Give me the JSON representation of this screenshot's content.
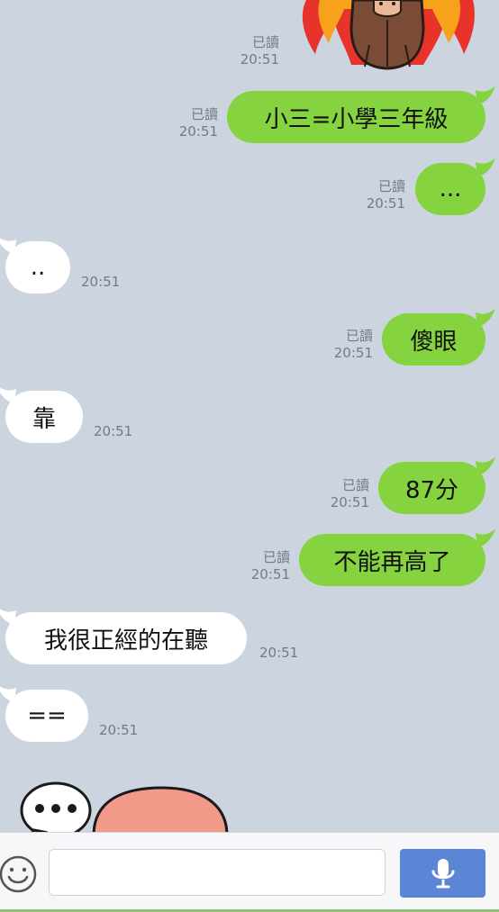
{
  "messages": [
    {
      "text": "小三=小學三年級",
      "read": "已讀",
      "time": "20:51"
    },
    {
      "text": "...",
      "read": "已讀",
      "time": "20:51"
    },
    {
      "text": "..",
      "time": "20:51"
    },
    {
      "text": "傻眼",
      "read": "已讀",
      "time": "20:51"
    },
    {
      "text": "靠",
      "time": "20:51"
    },
    {
      "text": "87分",
      "read": "已讀",
      "time": "20:51"
    },
    {
      "text": "不能再高了",
      "read": "已讀",
      "time": "20:51"
    },
    {
      "text": "我很正經的在聽",
      "time": "20:51"
    },
    {
      "text": "==",
      "time": "20:51"
    }
  ],
  "sticker_top": {
    "read": "已讀",
    "time": "20:51"
  },
  "input": {
    "placeholder": ""
  },
  "icons": {
    "emoji": "smiley-icon",
    "mic": "microphone-icon"
  },
  "colors": {
    "background": "#ccd4e0",
    "outgoing_bubble": "#84d33f",
    "incoming_bubble": "#ffffff",
    "mic_button": "#5b86d6"
  }
}
